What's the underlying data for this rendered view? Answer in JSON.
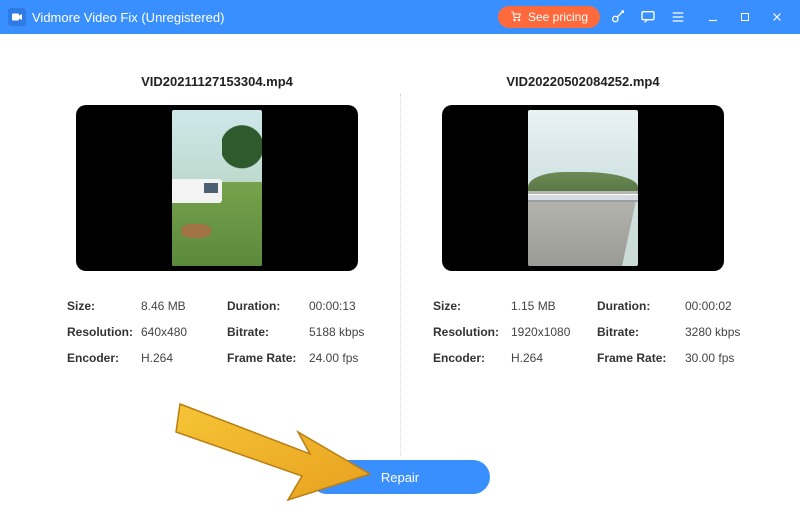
{
  "titlebar": {
    "app_name": "Vidmore Video Fix (Unregistered)",
    "pricing_label": "See pricing"
  },
  "left": {
    "filename": "VID20211127153304.mp4",
    "size_k": "Size:",
    "size_v": "8.46 MB",
    "dur_k": "Duration:",
    "dur_v": "00:00:13",
    "res_k": "Resolution:",
    "res_v": "640x480",
    "bit_k": "Bitrate:",
    "bit_v": "5188 kbps",
    "enc_k": "Encoder:",
    "enc_v": "H.264",
    "fr_k": "Frame Rate:",
    "fr_v": "24.00 fps"
  },
  "right": {
    "filename": "VID20220502084252.mp4",
    "size_k": "Size:",
    "size_v": "1.15 MB",
    "dur_k": "Duration:",
    "dur_v": "00:00:02",
    "res_k": "Resolution:",
    "res_v": "1920x1080",
    "bit_k": "Bitrate:",
    "bit_v": "3280 kbps",
    "enc_k": "Encoder:",
    "enc_v": "H.264",
    "fr_k": "Frame Rate:",
    "fr_v": "30.00 fps"
  },
  "actions": {
    "repair_label": "Repair"
  }
}
